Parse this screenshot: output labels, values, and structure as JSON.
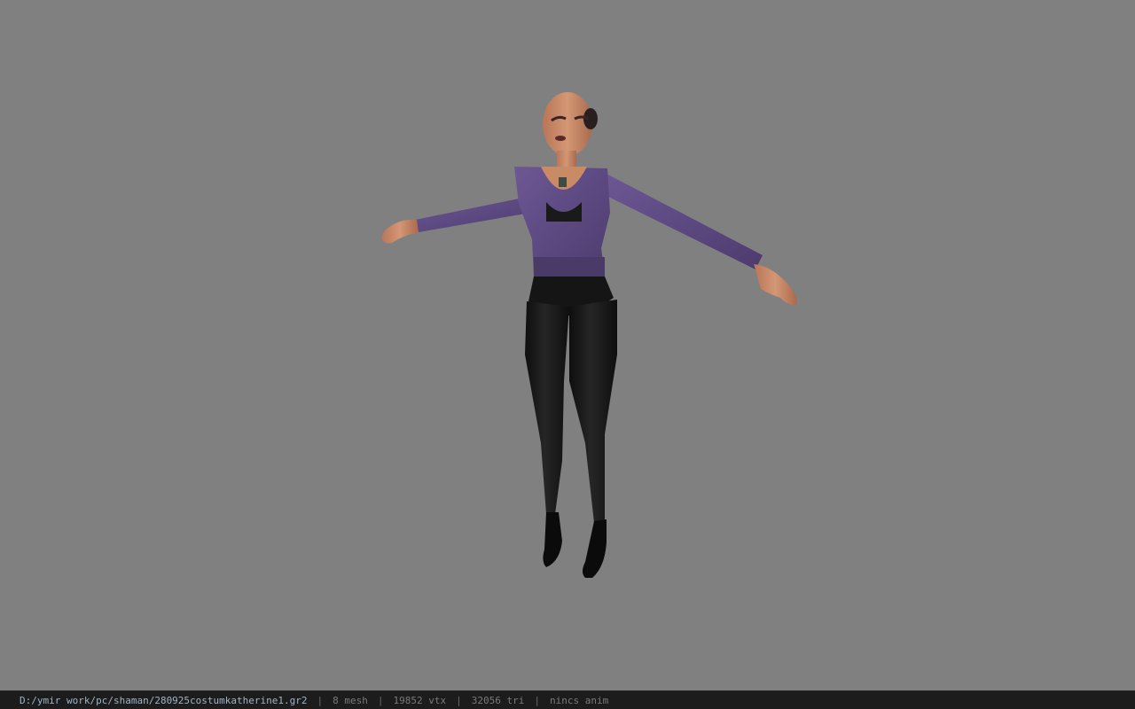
{
  "viewport": {
    "background": "#808080",
    "model_name": "costumkatherine1"
  },
  "statusbar": {
    "file_path": "D:/ymir work/pc/shaman/280925costumkatherine1.gr2",
    "mesh_count": "8 mesh",
    "vertex_count": "19852 vtx",
    "triangle_count": "32056 tri",
    "anim_status": "nincs anim",
    "separator": "|"
  },
  "colors": {
    "cardigan": "#5e4a82",
    "pants": "#141414",
    "skin": "#c98a66",
    "statusbar_bg": "#1c1c1c",
    "path_text": "#9fb4c8"
  }
}
